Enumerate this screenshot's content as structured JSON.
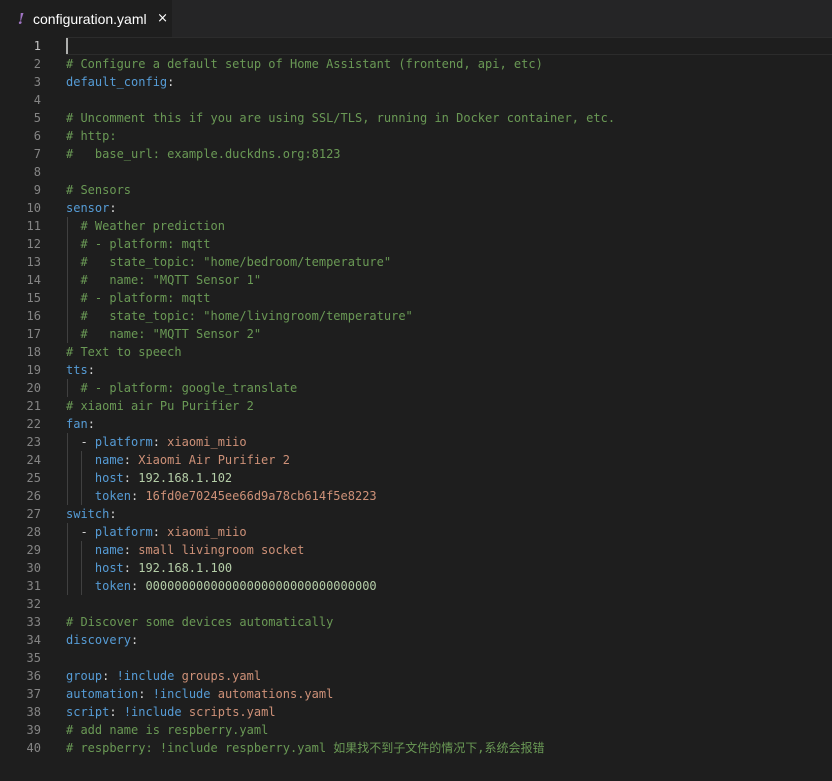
{
  "tab": {
    "icon": "!",
    "title": "configuration.yaml",
    "close": "×"
  },
  "editor": {
    "active_line": 1,
    "lines": [
      {
        "n": "1",
        "indent": 0,
        "segs": []
      },
      {
        "n": "2",
        "indent": 0,
        "segs": [
          [
            "c",
            "# Configure a default setup of Home Assistant (frontend, api, etc)"
          ]
        ]
      },
      {
        "n": "3",
        "indent": 0,
        "segs": [
          [
            "k",
            "default_config"
          ],
          [
            "p",
            ":"
          ]
        ]
      },
      {
        "n": "4",
        "indent": 0,
        "segs": []
      },
      {
        "n": "5",
        "indent": 0,
        "segs": [
          [
            "c",
            "# Uncomment this if you are using SSL/TLS, running in Docker container, etc."
          ]
        ]
      },
      {
        "n": "6",
        "indent": 0,
        "segs": [
          [
            "c",
            "# http:"
          ]
        ]
      },
      {
        "n": "7",
        "indent": 0,
        "segs": [
          [
            "c",
            "#   base_url: example.duckdns.org:8123"
          ]
        ]
      },
      {
        "n": "8",
        "indent": 0,
        "segs": []
      },
      {
        "n": "9",
        "indent": 0,
        "segs": [
          [
            "c",
            "# Sensors"
          ]
        ]
      },
      {
        "n": "10",
        "indent": 0,
        "segs": [
          [
            "k",
            "sensor"
          ],
          [
            "p",
            ":"
          ]
        ]
      },
      {
        "n": "11",
        "indent": 1,
        "segs": [
          [
            "c",
            "# Weather prediction"
          ]
        ]
      },
      {
        "n": "12",
        "indent": 1,
        "segs": [
          [
            "c",
            "# - platform: mqtt"
          ]
        ]
      },
      {
        "n": "13",
        "indent": 1,
        "segs": [
          [
            "c",
            "#   state_topic: \"home/bedroom/temperature\""
          ]
        ]
      },
      {
        "n": "14",
        "indent": 1,
        "segs": [
          [
            "c",
            "#   name: \"MQTT Sensor 1\""
          ]
        ]
      },
      {
        "n": "15",
        "indent": 1,
        "segs": [
          [
            "c",
            "# - platform: mqtt"
          ]
        ]
      },
      {
        "n": "16",
        "indent": 1,
        "segs": [
          [
            "c",
            "#   state_topic: \"home/livingroom/temperature\""
          ]
        ]
      },
      {
        "n": "17",
        "indent": 1,
        "segs": [
          [
            "c",
            "#   name: \"MQTT Sensor 2\""
          ]
        ]
      },
      {
        "n": "18",
        "indent": 0,
        "segs": [
          [
            "c",
            "# Text to speech"
          ]
        ]
      },
      {
        "n": "19",
        "indent": 0,
        "segs": [
          [
            "k",
            "tts"
          ],
          [
            "p",
            ":"
          ]
        ]
      },
      {
        "n": "20",
        "indent": 1,
        "segs": [
          [
            "c",
            "# - platform: google_translate"
          ]
        ]
      },
      {
        "n": "21",
        "indent": 0,
        "segs": [
          [
            "c",
            "# xiaomi air Pu Purifier 2"
          ]
        ]
      },
      {
        "n": "22",
        "indent": 0,
        "segs": [
          [
            "k",
            "fan"
          ],
          [
            "p",
            ":"
          ]
        ]
      },
      {
        "n": "23",
        "indent": 1,
        "segs": [
          [
            "p",
            "- "
          ],
          [
            "k",
            "platform"
          ],
          [
            "p",
            ": "
          ],
          [
            "s",
            "xiaomi_miio"
          ]
        ]
      },
      {
        "n": "24",
        "indent": 2,
        "segs": [
          [
            "k",
            "name"
          ],
          [
            "p",
            ": "
          ],
          [
            "s",
            "Xiaomi Air Purifier 2"
          ]
        ]
      },
      {
        "n": "25",
        "indent": 2,
        "segs": [
          [
            "k",
            "host"
          ],
          [
            "p",
            ": "
          ],
          [
            "n",
            "192.168.1.102"
          ]
        ]
      },
      {
        "n": "26",
        "indent": 2,
        "segs": [
          [
            "k",
            "token"
          ],
          [
            "p",
            ": "
          ],
          [
            "s",
            "16fd0e70245ee66d9a78cb614f5e8223"
          ]
        ]
      },
      {
        "n": "27",
        "indent": 0,
        "segs": [
          [
            "k",
            "switch"
          ],
          [
            "p",
            ":"
          ]
        ]
      },
      {
        "n": "28",
        "indent": 1,
        "segs": [
          [
            "p",
            "- "
          ],
          [
            "k",
            "platform"
          ],
          [
            "p",
            ": "
          ],
          [
            "s",
            "xiaomi_miio"
          ]
        ]
      },
      {
        "n": "29",
        "indent": 2,
        "segs": [
          [
            "k",
            "name"
          ],
          [
            "p",
            ": "
          ],
          [
            "s",
            "small livingroom socket"
          ]
        ]
      },
      {
        "n": "30",
        "indent": 2,
        "segs": [
          [
            "k",
            "host"
          ],
          [
            "p",
            ": "
          ],
          [
            "n",
            "192.168.1.100"
          ]
        ]
      },
      {
        "n": "31",
        "indent": 2,
        "segs": [
          [
            "k",
            "token"
          ],
          [
            "p",
            ": "
          ],
          [
            "n",
            "00000000000000000000000000000000"
          ]
        ]
      },
      {
        "n": "32",
        "indent": 0,
        "segs": []
      },
      {
        "n": "33",
        "indent": 0,
        "segs": [
          [
            "c",
            "# Discover some devices automatically"
          ]
        ]
      },
      {
        "n": "34",
        "indent": 0,
        "segs": [
          [
            "k",
            "discovery"
          ],
          [
            "p",
            ":"
          ]
        ]
      },
      {
        "n": "35",
        "indent": 0,
        "segs": []
      },
      {
        "n": "36",
        "indent": 0,
        "segs": [
          [
            "k",
            "group"
          ],
          [
            "p",
            ": "
          ],
          [
            "t",
            "!include"
          ],
          [
            "p",
            " "
          ],
          [
            "s",
            "groups.yaml"
          ]
        ]
      },
      {
        "n": "37",
        "indent": 0,
        "segs": [
          [
            "k",
            "automation"
          ],
          [
            "p",
            ": "
          ],
          [
            "t",
            "!include"
          ],
          [
            "p",
            " "
          ],
          [
            "s",
            "automations.yaml"
          ]
        ]
      },
      {
        "n": "38",
        "indent": 0,
        "segs": [
          [
            "k",
            "script"
          ],
          [
            "p",
            ": "
          ],
          [
            "t",
            "!include"
          ],
          [
            "p",
            " "
          ],
          [
            "s",
            "scripts.yaml"
          ]
        ]
      },
      {
        "n": "39",
        "indent": 0,
        "segs": [
          [
            "c",
            "# add name is respberry.yaml"
          ]
        ]
      },
      {
        "n": "40",
        "indent": 0,
        "segs": [
          [
            "c",
            "# respberry: !include respberry.yaml 如果找不到子文件的情况下,系统会报错"
          ]
        ]
      }
    ]
  }
}
